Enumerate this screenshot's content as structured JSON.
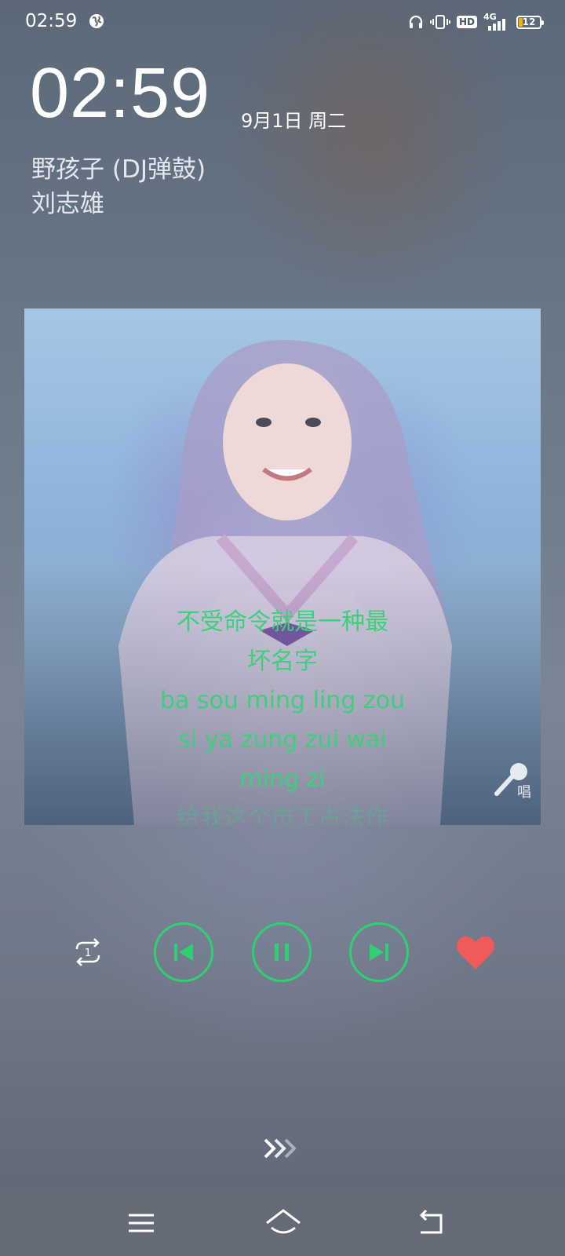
{
  "status_bar": {
    "time": "02:59",
    "battery": "12",
    "network": "4G"
  },
  "lockscreen": {
    "clock": "02:59",
    "date": "9月1日 周二"
  },
  "music": {
    "title": "野孩子 (DJ弹鼓)",
    "artist": "刘志雄",
    "lyrics": [
      "不受命令就是一种最",
      "坏名字",
      "ba sou ming ling zou",
      "si ya zung zui wai",
      "ming zi"
    ],
    "lyrics_next_faded": "给我这个市工占法作",
    "sing_label": "唱",
    "accent_color": "#2fcf74",
    "heart_color": "#f05a5a",
    "repeat_count": "1"
  },
  "icons": {
    "repeat": "repeat-one-icon",
    "previous": "skip-previous-icon",
    "pause": "pause-icon",
    "next": "skip-next-icon",
    "favorite": "heart-icon",
    "microphone": "microphone-icon",
    "swipe": "chevron-right-icon",
    "menu": "menu-icon",
    "home": "home-icon",
    "back": "back-icon"
  }
}
